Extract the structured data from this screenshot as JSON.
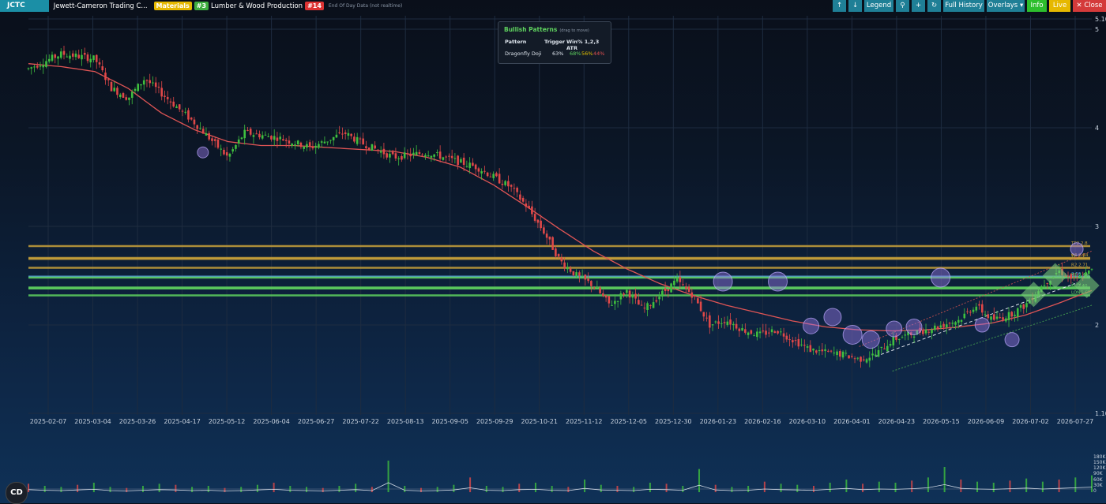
{
  "header": {
    "ticker": "JCTC",
    "company": "Jewett-Cameron Trading C...",
    "sector": "Materials",
    "sector_rank": "#3",
    "industry": "Lumber & Wood Production",
    "industry_rank": "#14",
    "data_note": "End Of Day Data (not realtime)"
  },
  "toolbar": {
    "up_icon": "arrow-up-icon",
    "down_icon": "arrow-down-icon",
    "legend": "Legend",
    "zoom_icon": "zoom-icon",
    "add_icon": "plus-icon",
    "refresh_icon": "refresh-icon",
    "full_history": "Full History",
    "overlays": "Overlays",
    "info": "Info",
    "live": "Live",
    "close": "Close"
  },
  "patterns_panel": {
    "title": "Bullish Patterns",
    "subtitle": "(drag to move)",
    "col_pattern": "Pattern",
    "col_trigger": "Trigger",
    "col_win": "Win% 1,2,3 ATR",
    "row_pattern": "Dragonfly Doji",
    "row_trigger": "63%",
    "win1": "68%",
    "win2": "56%",
    "win3": "44%",
    "colors": {
      "win1": "#5fd35f",
      "win2": "#e6c200",
      "win3": "#e05050"
    }
  },
  "levels": [
    {
      "label": "TP2 2.8",
      "value": 2.8,
      "color": "#c8a13a"
    },
    {
      "label": "R3 2.84",
      "value": 2.68,
      "color": "#c8a13a"
    },
    {
      "label": "TP 2.7",
      "value": 2.67,
      "color": "#c8a13a"
    },
    {
      "label": "R2 2.71",
      "value": 2.58,
      "color": "#c8a13a"
    },
    {
      "label": "2.56",
      "value": 2.49,
      "color": "#5aa8e0"
    },
    {
      "label": "R1 2.4",
      "value": 2.48,
      "color": "#5fd35f"
    },
    {
      "label": "2.39",
      "value": 2.38,
      "color": "#5fd35f"
    },
    {
      "label": "SL 2.40",
      "value": 2.37,
      "color": "#5fd35f"
    },
    {
      "label": "LONG ST",
      "value": 2.3,
      "color": "#5fd35f"
    }
  ],
  "logo_text": "CD",
  "chart_data": {
    "type": "candlestick",
    "y_ticks": [
      "5.10",
      "5",
      "4",
      "3",
      "2",
      "1.10"
    ],
    "ylim": [
      1.1,
      5.1
    ],
    "x_ticks": [
      "2025-02-07",
      "2025-03-04",
      "2025-03-26",
      "2025-04-17",
      "2025-05-12",
      "2025-06-04",
      "2025-06-27",
      "2025-07-22",
      "2025-08-13",
      "2025-09-05",
      "2025-09-29",
      "2025-10-21",
      "2025-11-12",
      "2025-12-05",
      "2025-12-30",
      "2026-01-23",
      "2026-02-16",
      "2026-03-10",
      "2026-04-01",
      "2026-04-23",
      "2026-05-15",
      "2026-06-09",
      "2026-07-02",
      "2026-07-27"
    ],
    "price_path": [
      [
        0,
        4.6
      ],
      [
        2,
        4.75
      ],
      [
        4,
        4.7
      ],
      [
        5,
        4.4
      ],
      [
        6,
        4.3
      ],
      [
        7,
        4.5
      ],
      [
        8,
        4.35
      ],
      [
        10,
        4.05
      ],
      [
        12,
        3.7
      ],
      [
        13,
        3.95
      ],
      [
        15,
        3.9
      ],
      [
        17,
        3.8
      ],
      [
        19,
        3.95
      ],
      [
        20,
        3.85
      ],
      [
        22,
        3.7
      ],
      [
        24,
        3.75
      ],
      [
        25,
        3.7
      ],
      [
        27,
        3.6
      ],
      [
        29,
        3.4
      ],
      [
        30,
        3.2
      ],
      [
        31,
        2.95
      ],
      [
        32,
        2.65
      ],
      [
        33,
        2.5
      ],
      [
        34,
        2.4
      ],
      [
        35,
        2.2
      ],
      [
        36,
        2.35
      ],
      [
        37,
        2.15
      ],
      [
        38,
        2.3
      ],
      [
        39,
        2.45
      ],
      [
        40,
        2.3
      ],
      [
        41,
        2.0
      ],
      [
        42,
        2.05
      ],
      [
        43,
        1.95
      ],
      [
        44,
        1.9
      ],
      [
        45,
        1.95
      ],
      [
        46,
        1.85
      ],
      [
        47,
        1.75
      ],
      [
        48,
        1.72
      ],
      [
        49,
        1.7
      ],
      [
        50,
        1.65
      ],
      [
        51,
        1.7
      ],
      [
        52,
        1.85
      ],
      [
        53,
        1.9
      ],
      [
        54,
        1.95
      ],
      [
        55,
        2.0
      ],
      [
        56,
        2.05
      ],
      [
        57,
        2.2
      ],
      [
        58,
        2.05
      ],
      [
        59,
        2.1
      ],
      [
        60,
        2.2
      ],
      [
        61,
        2.4
      ],
      [
        62,
        2.55
      ],
      [
        63,
        2.45
      ],
      [
        64,
        2.55
      ]
    ],
    "ma_path": [
      [
        0,
        4.65
      ],
      [
        2,
        4.62
      ],
      [
        4,
        4.57
      ],
      [
        6,
        4.4
      ],
      [
        8,
        4.15
      ],
      [
        10,
        3.98
      ],
      [
        12,
        3.86
      ],
      [
        14,
        3.82
      ],
      [
        16,
        3.82
      ],
      [
        18,
        3.8
      ],
      [
        20,
        3.78
      ],
      [
        22,
        3.76
      ],
      [
        24,
        3.7
      ],
      [
        26,
        3.6
      ],
      [
        28,
        3.42
      ],
      [
        30,
        3.2
      ],
      [
        32,
        2.97
      ],
      [
        34,
        2.75
      ],
      [
        36,
        2.57
      ],
      [
        38,
        2.42
      ],
      [
        40,
        2.3
      ],
      [
        42,
        2.2
      ],
      [
        44,
        2.12
      ],
      [
        46,
        2.04
      ],
      [
        48,
        1.98
      ],
      [
        50,
        1.95
      ],
      [
        52,
        1.94
      ],
      [
        54,
        1.95
      ],
      [
        56,
        1.98
      ],
      [
        58,
        2.02
      ],
      [
        60,
        2.1
      ],
      [
        62,
        2.22
      ],
      [
        64,
        2.35
      ]
    ],
    "volume_labels": [
      "180K",
      "150K",
      "120K",
      "90K",
      "60K",
      "30K",
      "0"
    ],
    "volume": [
      8,
      6,
      5,
      7,
      9,
      5,
      4,
      6,
      8,
      7,
      5,
      6,
      4,
      5,
      7,
      9,
      6,
      5,
      4,
      6,
      8,
      5,
      30,
      6,
      4,
      5,
      7,
      14,
      6,
      5,
      8,
      9,
      6,
      5,
      12,
      7,
      6,
      5,
      9,
      8,
      6,
      22,
      7,
      5,
      6,
      10,
      8,
      7,
      6,
      9,
      12,
      8,
      10,
      9,
      11,
      14,
      24,
      12,
      10,
      9,
      11,
      13,
      10,
      12,
      14,
      16
    ]
  }
}
